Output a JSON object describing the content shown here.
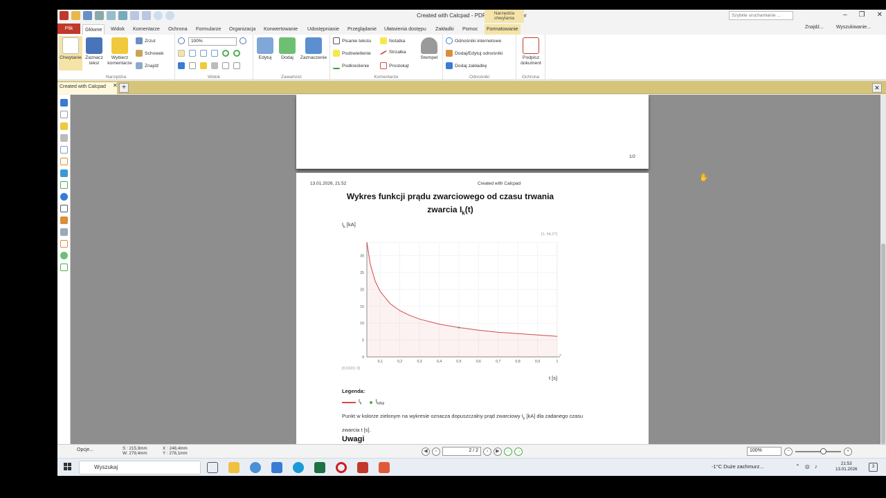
{
  "window": {
    "title": "Created with Calcpad - PDF-XChange Editor",
    "context_tab_header": "Narzędzia chwytania",
    "quick_search_placeholder": "Szybkie uruchamianie ..."
  },
  "ribbon_tabs": [
    "Plik",
    "Główne",
    "Widok",
    "Komentarze",
    "Ochrona",
    "Formularze",
    "Organizacja",
    "Konwertowanie",
    "Udostępnianie",
    "Przeglądanie",
    "Ułatwienia dostępu",
    "Zakładki",
    "Pomoc",
    "Formatowanie"
  ],
  "ribbon_right": {
    "find": "Znajdź...",
    "search": "Wyszukiwanie..."
  },
  "ribbon": {
    "narzedzia": {
      "label": "Narzędzia",
      "hand": "Chwytanie",
      "select_text": "Zaznacz tekst",
      "select_comments": "Wybierz komentarze",
      "snapshot": "Zrzut",
      "clipboard": "Schowek",
      "find": "Znajdź"
    },
    "widok": {
      "label": "Widok",
      "zoom": "100%"
    },
    "zawartosc": {
      "label": "Zawartość",
      "edit": "Edytuj",
      "add": "Dodaj",
      "select": "Zaznaczenie"
    },
    "komentarze": {
      "label": "Komentarze",
      "typewriter": "Pisanie tekstu",
      "highlight": "Podświetlenie",
      "strikeout": "Podkreślenie",
      "note": "Notatka",
      "arrow": "Strzałka",
      "rect": "Prostokąt",
      "stamp": "Stempel"
    },
    "odnosniki": {
      "label": "Odnośniki",
      "web_links": "Odnośniki internetowe",
      "add_edit_links": "Dodaj/Edytuj odnośniki",
      "add_bookmark": "Dodaj zakładkę"
    },
    "ochrona": {
      "label": "Ochrona",
      "sign": "Podpisz dokument"
    }
  },
  "doc_tab": {
    "label": "Created with Calcpad"
  },
  "page1": {
    "page_number": "1/2"
  },
  "page2": {
    "date": "13.01.2026, 21:52",
    "created": "Created with Calcpad",
    "title_line1": "Wykres funkcji prądu zwarciowego od czasu trwania",
    "title_line2_pre": "zwarcia I",
    "title_line2_sub": "k",
    "title_line2_post": "(t)",
    "ylabel_main": "I",
    "ylabel_sub": "k",
    "ylabel_unit": " [kA]",
    "corner_label": "[1; 94,27]",
    "origin_label": "[0,0323; 0]",
    "xlabel": "t [s]",
    "legend_title": "Legenda:",
    "legend_ik": "I",
    "legend_ik_sub": "k",
    "legend_ikdop": "I",
    "legend_ikdop_sub": "kdop",
    "para_part1": "Punkt w kolorze zielonym na wykresie oznacza dopuszczalny prąd zwarciowy I",
    "para_sub": "k",
    "para_part2": " [kA] dla zadanego czasu",
    "para_line2": "zwarcia t [s].",
    "uwagi": "Uwagi"
  },
  "chart_data": {
    "type": "area",
    "title": "",
    "xlabel": "t [s]",
    "ylabel": "Ik [kA]",
    "xlim": [
      0.0323,
      1
    ],
    "ylim": [
      0,
      34
    ],
    "x_ticks": [
      "0,1",
      "0,2",
      "0,3",
      "0,4",
      "0,5",
      "0,6",
      "0,7",
      "0,8",
      "0,9",
      "1"
    ],
    "y_ticks": [
      "0",
      "5",
      "10",
      "15",
      "20",
      "25",
      "30"
    ],
    "grid": true,
    "series": [
      {
        "name": "Ik",
        "color": "#d04a4a",
        "x": [
          0.0323,
          0.05,
          0.075,
          0.1,
          0.15,
          0.2,
          0.25,
          0.3,
          0.4,
          0.5,
          0.6,
          0.7,
          0.8,
          0.9,
          1.0
        ],
        "y": [
          34,
          27.4,
          22.4,
          19.4,
          15.8,
          13.7,
          12.3,
          11.2,
          9.7,
          8.7,
          7.9,
          7.3,
          6.9,
          6.5,
          6.1
        ]
      },
      {
        "name": "Ikdop",
        "color": "#5aa34b",
        "x": [
          0.5
        ],
        "y": [
          8.7
        ]
      }
    ]
  },
  "statusbar": {
    "options": "Opcje...",
    "size_w": "S : 215,9mm",
    "size_h": "W: 279,4mm",
    "pos_x": "X : 248,4mm",
    "pos_y": "Y : 278,1mm",
    "page": "2 / 2",
    "zoom": "100%"
  },
  "taskbar": {
    "search": "Wyszukaj",
    "weather": "-1°C  Duże zachmurz...",
    "time": "21:53",
    "date": "13.01.2026",
    "notifications": "3"
  }
}
